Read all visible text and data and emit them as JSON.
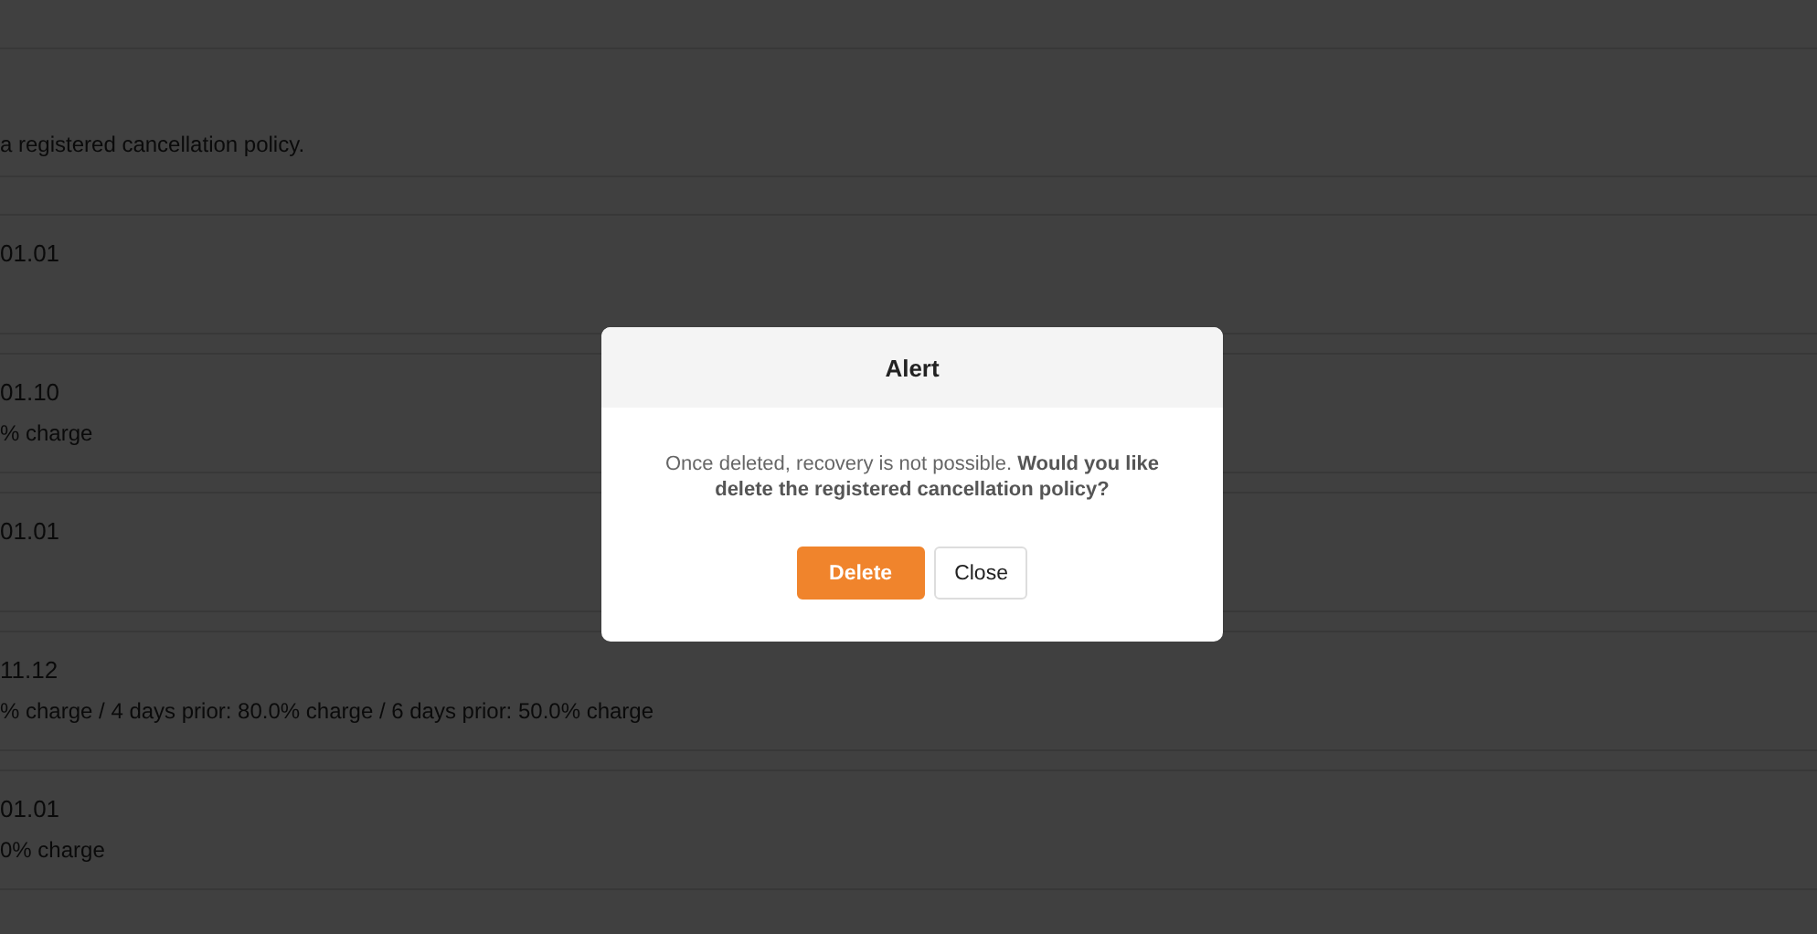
{
  "notice": "a registered cancellation policy.",
  "policies": [
    {
      "date": "01.01"
    },
    {
      "date": "01.10",
      "detail": "% charge"
    },
    {
      "date": "01.01"
    },
    {
      "date": "11.12",
      "detail": "% charge / 4 days prior: 80.0% charge / 6 days prior: 50.0% charge"
    },
    {
      "date": "01.01",
      "detail": "0% charge"
    }
  ],
  "dialog": {
    "title": "Alert",
    "message": "Once deleted, recovery is not possible. **Would you like delete the registered cancellation policy?**",
    "buttons": [
      {
        "label": "Delete",
        "kind": "primary"
      },
      {
        "label": "Close",
        "kind": "secondary"
      }
    ]
  }
}
